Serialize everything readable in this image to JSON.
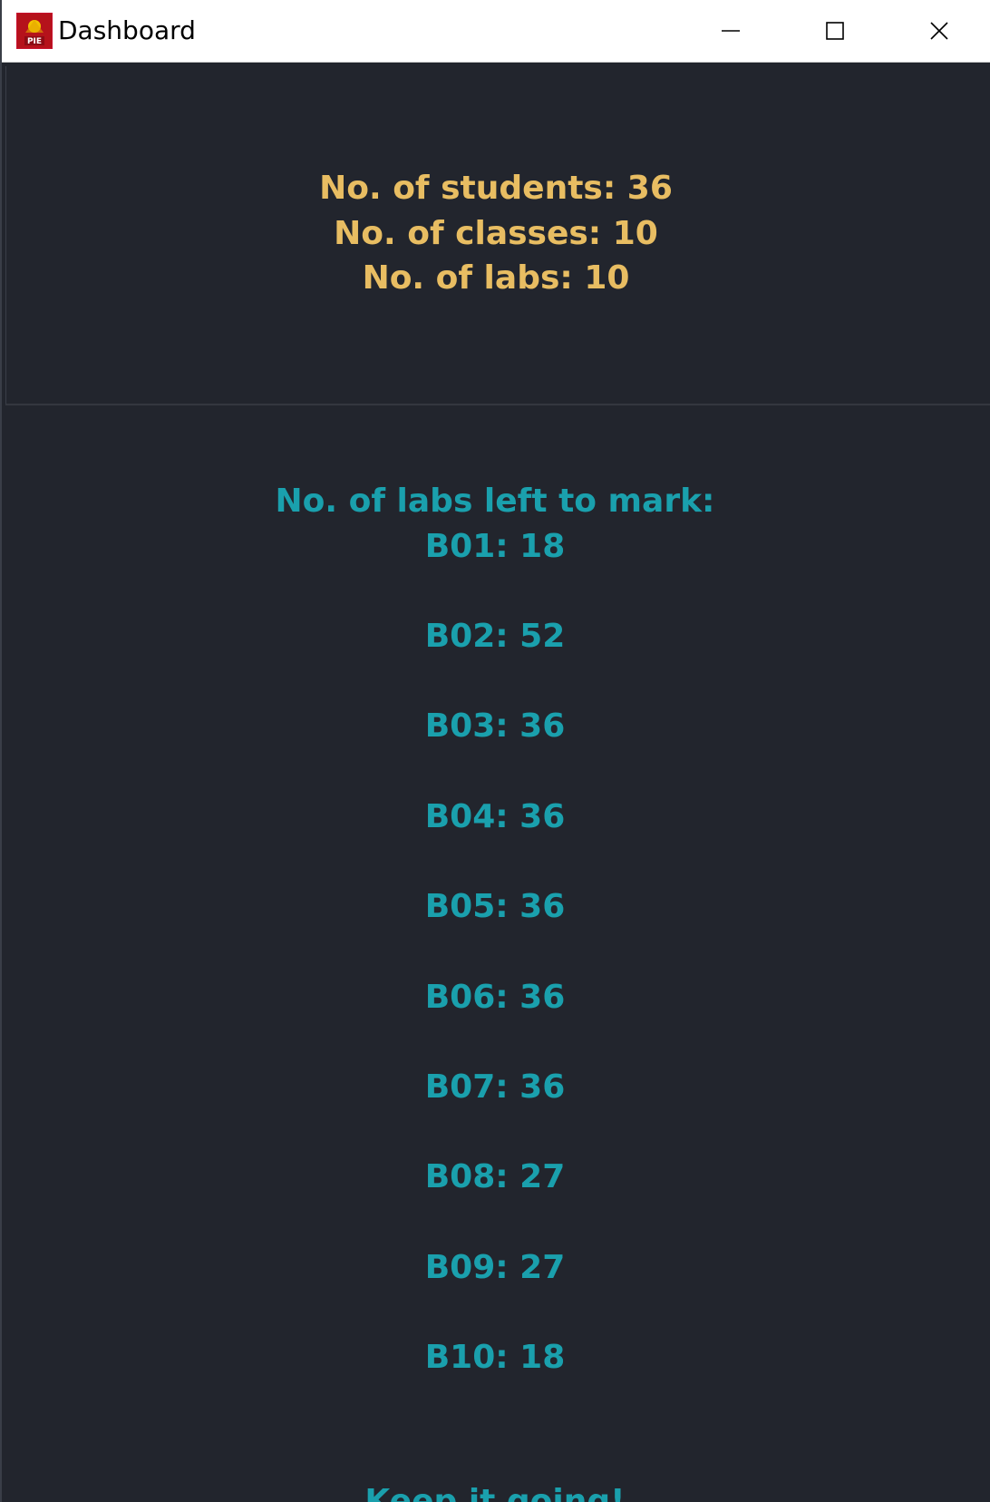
{
  "window": {
    "title": "Dashboard",
    "icon_name": "app-logo-icon",
    "controls": {
      "minimize": "minimize-icon",
      "maximize": "maximize-icon",
      "close": "close-icon"
    }
  },
  "stats": {
    "students": "No. of students: 36",
    "classes": "No. of classes: 10",
    "labs": "No. of labs: 10"
  },
  "labs_left": {
    "heading": "No. of labs left to mark:",
    "items": [
      "B01: 18",
      "B02: 52",
      "B03: 36",
      "B04: 36",
      "B05: 36",
      "B06: 36",
      "B07: 36",
      "B08: 27",
      "B09: 27",
      "B10: 18"
    ]
  },
  "footer": {
    "message": "Keep it going!"
  },
  "colors": {
    "background": "#22252d",
    "stats_text": "#e8bd62",
    "labs_text": "#1aa0ad"
  }
}
